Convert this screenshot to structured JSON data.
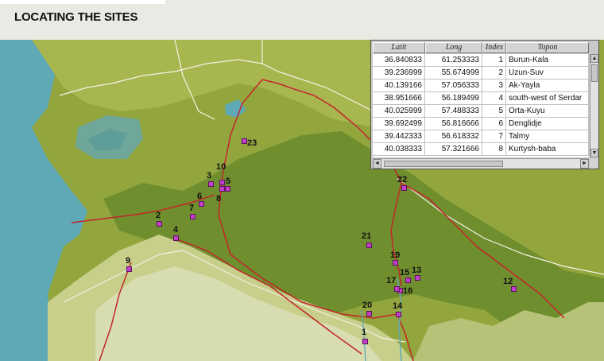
{
  "title": "LOCATING THE SITES",
  "colors": {
    "sea": "#5fa8b6",
    "lowland": "#6f8f2e",
    "plain": "#93a63e",
    "mountain": "#c7cf8b",
    "route": "#c2262b",
    "border": "#f2f2e4",
    "marker": "#c23ec8"
  },
  "table": {
    "headers": [
      "Latit",
      "Long",
      "Index",
      "Topon"
    ],
    "rows": [
      {
        "lat": "36.840833",
        "long": "61.253333",
        "index": "1",
        "topon": "Burun-Kala"
      },
      {
        "lat": "39.236999",
        "long": "55.674999",
        "index": "2",
        "topon": "Uzun-Suv"
      },
      {
        "lat": "40.139166",
        "long": "57.056333",
        "index": "3",
        "topon": "Ak-Yayla"
      },
      {
        "lat": "38.951666",
        "long": "56.189499",
        "index": "4",
        "topon": "south-west of Serdar"
      },
      {
        "lat": "40.025999",
        "long": "57.488333",
        "index": "5",
        "topon": "Orta-Kuyu"
      },
      {
        "lat": "39.692499",
        "long": "56.816666",
        "index": "6",
        "topon": "Denglidje"
      },
      {
        "lat": "39.442333",
        "long": "56.618332",
        "index": "7",
        "topon": "Talmy"
      },
      {
        "lat": "40.038333",
        "long": "57.321666",
        "index": "8",
        "topon": "Kurtysh-baba"
      }
    ],
    "scroll_up": "▲",
    "scroll_down": "▼",
    "scroll_left": "◄",
    "scroll_right": "►"
  },
  "sites": [
    {
      "label": "1"
    },
    {
      "label": "2"
    },
    {
      "label": "3"
    },
    {
      "label": "4"
    },
    {
      "label": "5"
    },
    {
      "label": "6"
    },
    {
      "label": "7"
    },
    {
      "label": "8"
    },
    {
      "label": "9"
    },
    {
      "label": "10"
    },
    {
      "label": "12"
    },
    {
      "label": "13"
    },
    {
      "label": "14"
    },
    {
      "label": "15"
    },
    {
      "label": "16"
    },
    {
      "label": "17"
    },
    {
      "label": "19"
    },
    {
      "label": "20"
    },
    {
      "label": "21"
    },
    {
      "label": "22"
    },
    {
      "label": "23"
    }
  ]
}
